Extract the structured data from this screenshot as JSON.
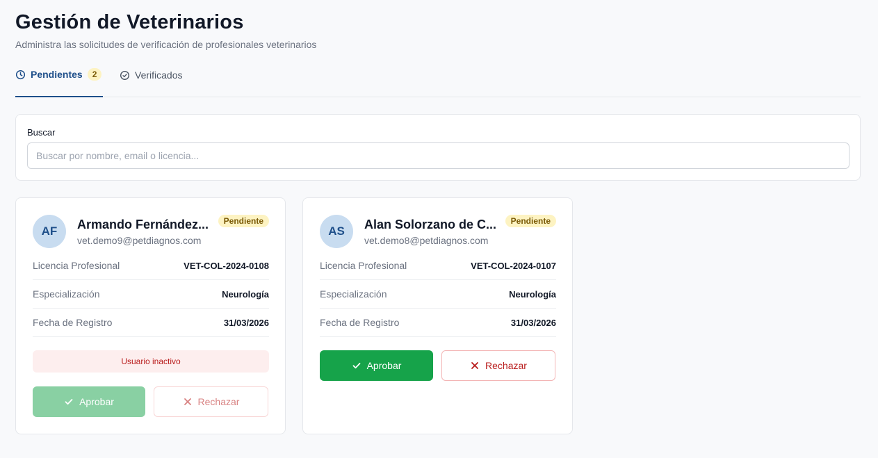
{
  "header": {
    "title": "Gestión de Veterinarios",
    "subtitle": "Administra las solicitudes de verificación de profesionales veterinarios"
  },
  "tabs": [
    {
      "label": "Pendientes",
      "count": "2",
      "icon": "clock-icon",
      "active": true
    },
    {
      "label": "Verificados",
      "icon": "check-circle-icon",
      "active": false
    }
  ],
  "search": {
    "label": "Buscar",
    "placeholder": "Buscar por nombre, email o licencia...",
    "value": ""
  },
  "fields": {
    "license": "Licencia Profesional",
    "specialization": "Especialización",
    "registered": "Fecha de Registro"
  },
  "actions": {
    "approve": "Aprobar",
    "reject": "Rechazar"
  },
  "veterinarians": [
    {
      "initials": "AF",
      "name": "Armando Fernández...",
      "email": "vet.demo9@petdiagnos.com",
      "status": "Pendiente",
      "license": "VET-COL-2024-0108",
      "specialization": "Neurología",
      "registered": "31/03/2026",
      "alert": "Usuario inactivo"
    },
    {
      "initials": "AS",
      "name": "Alan Solorzano de C...",
      "email": "vet.demo8@petdiagnos.com",
      "status": "Pendiente",
      "license": "VET-COL-2024-0107",
      "specialization": "Neurología",
      "registered": "31/03/2026"
    }
  ],
  "colors": {
    "primary": "#1e4f8a",
    "approve": "#16a34a",
    "reject": "#b91c1c",
    "pending_badge": "#fdf3c2"
  }
}
